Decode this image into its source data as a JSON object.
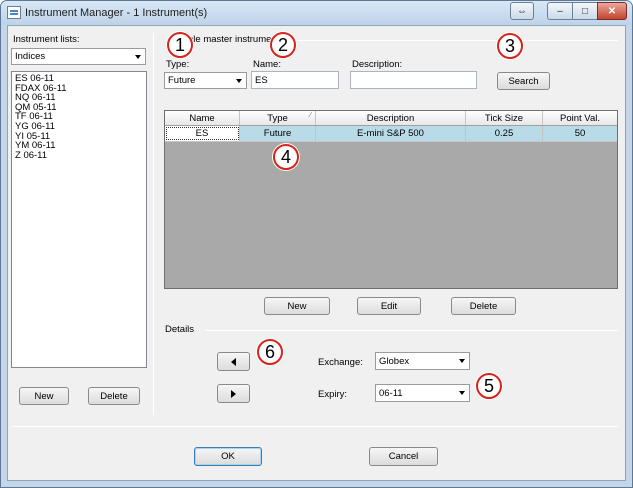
{
  "window": {
    "title": "Instrument Manager - 1 Instrument(s)",
    "controls": {
      "restore": "⇔",
      "minimize": "–",
      "maximize": "□",
      "close": "✕"
    }
  },
  "left_panel": {
    "lists_label": "Instrument lists:",
    "selected_list": "Indices",
    "instruments": [
      "ES 06-11",
      "FDAX 06-11",
      "NQ 06-11",
      "QM 05-11",
      "TF 06-11",
      "YG 06-11",
      "YI 05-11",
      "YM 06-11",
      "Z 06-11"
    ],
    "new_button": "New",
    "delete_button": "Delete"
  },
  "search": {
    "group_title": "ple master instrume",
    "type_label": "Type:",
    "type_value": "Future",
    "name_label": "Name:",
    "name_value": "ES",
    "description_label": "Description:",
    "description_value": "",
    "search_button": "Search"
  },
  "grid": {
    "columns": [
      "Name",
      "Type",
      "Description",
      "Tick Size",
      "Point Val."
    ],
    "rows": [
      {
        "name": "ES",
        "type": "Future",
        "description": "E-mini S&P 500",
        "tick_size": "0.25",
        "point_value": "50"
      }
    ],
    "new_button": "New",
    "edit_button": "Edit",
    "delete_button": "Delete"
  },
  "details": {
    "label": "Details",
    "exchange_label": "Exchange:",
    "exchange_value": "Globex",
    "expiry_label": "Expiry:",
    "expiry_value": "06-11"
  },
  "footer": {
    "ok_button": "OK",
    "cancel_button": "Cancel"
  },
  "callouts": [
    "1",
    "2",
    "3",
    "4",
    "5",
    "6"
  ]
}
